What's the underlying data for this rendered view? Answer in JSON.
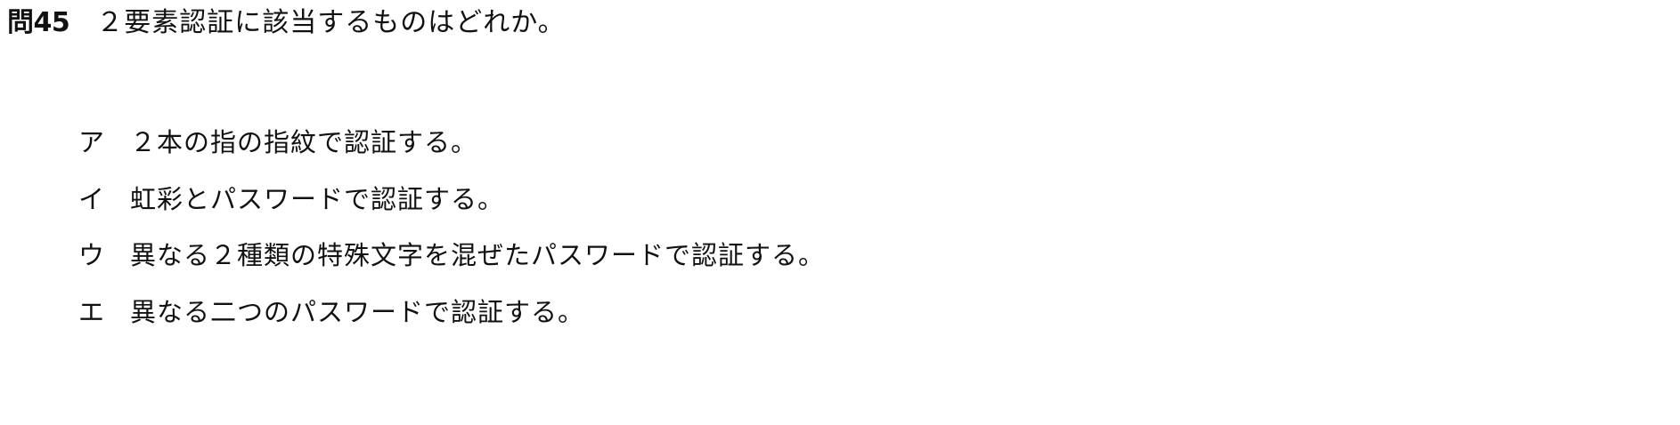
{
  "question": {
    "number": "問45",
    "text": "２要素認証に該当するものはどれか。"
  },
  "choices": [
    {
      "mark": "ア",
      "text": "２本の指の指紋で認証する。"
    },
    {
      "mark": "イ",
      "text": "虹彩とパスワードで認証する。"
    },
    {
      "mark": "ウ",
      "text": "異なる２種類の特殊文字を混ぜたパスワードで認証する。"
    },
    {
      "mark": "エ",
      "text": "異なる二つのパスワードで認証する。"
    }
  ]
}
